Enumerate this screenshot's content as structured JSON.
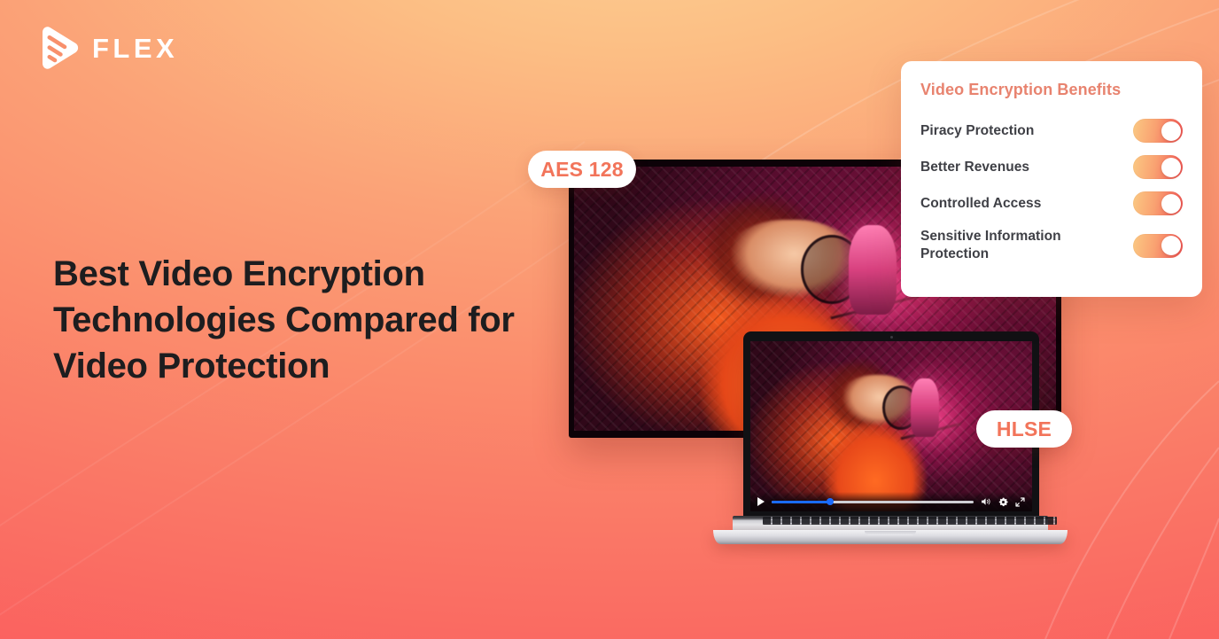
{
  "brand": {
    "name": "FLEX",
    "logo_icon": "flex-play-mark",
    "logo_color": "#FFFFFF"
  },
  "headline": {
    "text": "Best Video Encryption Technologies Compared for Video Protection",
    "color": "#1D1D1F"
  },
  "tags": {
    "aes": "AES 128",
    "hlse": "HLSE",
    "tag_text_color": "#F2745A"
  },
  "benefits_card": {
    "title": "Video Encryption Benefits",
    "title_color": "#E8836F",
    "items": [
      {
        "label": "Piracy Protection",
        "enabled": true
      },
      {
        "label": "Better Revenues",
        "enabled": true
      },
      {
        "label": "Controlled Access",
        "enabled": true
      },
      {
        "label": "Sensitive Information Protection",
        "enabled": true
      }
    ]
  },
  "video_player": {
    "play_icon": "play-icon",
    "volume_icon": "volume-icon",
    "settings_icon": "gear-icon",
    "fullscreen_icon": "fullscreen-icon",
    "progress_percent": 29,
    "progress_color": "#1A6BFF"
  },
  "theme": {
    "background_top_center": "#FBCA8C",
    "background_top_left": "#F5845F",
    "background_top_right": "#FB886B",
    "background_bottom_left": "#FB5158",
    "background_bottom_right": "#FB8A6F",
    "toggle_gradient_from": "#FBC983",
    "toggle_gradient_to": "#EF5350"
  }
}
